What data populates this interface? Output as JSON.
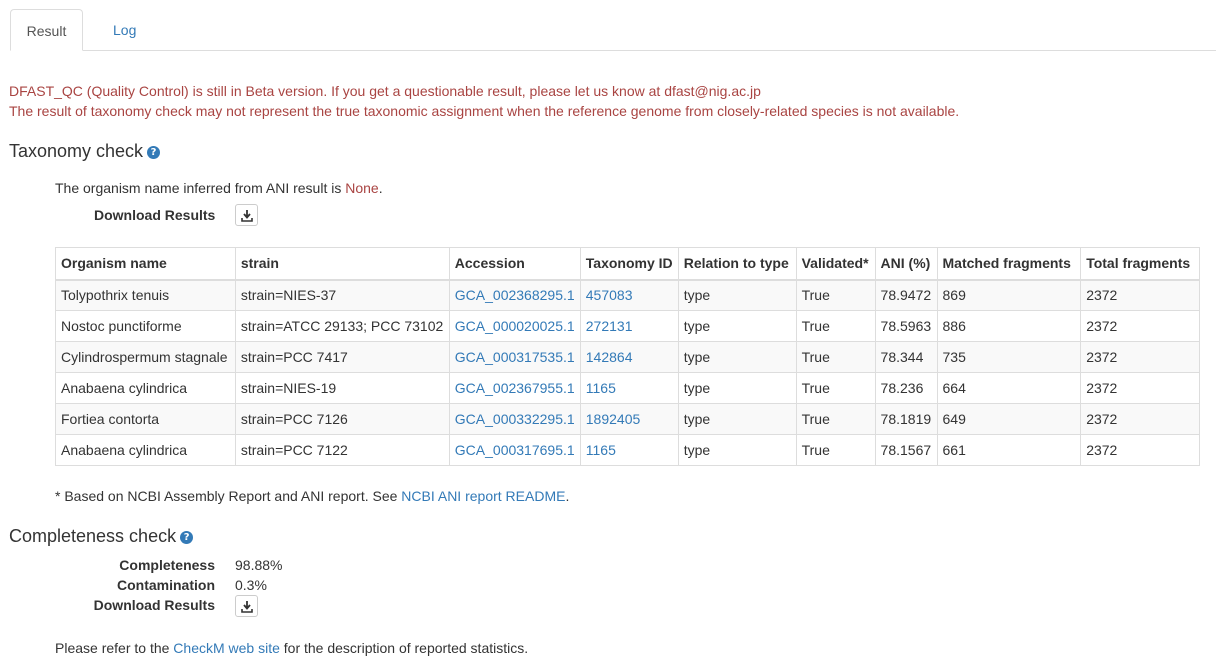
{
  "tabs": [
    {
      "label": "Result",
      "active": true
    },
    {
      "label": "Log",
      "active": false
    }
  ],
  "warnings": [
    "DFAST_QC (Quality Control) is still in Beta version. If you get a questionable result, please let us know at dfast@nig.ac.jp",
    "The result of taxonomy check may not represent the true taxonomic assignment when the reference genome from closely-related species is not available."
  ],
  "taxonomy": {
    "title": "Taxonomy check",
    "inferred_prefix": "The organism name inferred from ANI result is ",
    "inferred_value": "None",
    "inferred_suffix": ".",
    "download_label": "Download Results",
    "headers": [
      "Organism name",
      "strain",
      "Accession",
      "Taxonomy ID",
      "Relation to type",
      "Validated*",
      "ANI (%)",
      "Matched fragments",
      "Total fragments"
    ],
    "rows": [
      [
        "Tolypothrix tenuis",
        "strain=NIES-37",
        "GCA_002368295.1",
        "457083",
        "type",
        "True",
        "78.9472",
        "869",
        "2372"
      ],
      [
        "Nostoc punctiforme",
        "strain=ATCC 29133; PCC 73102",
        "GCA_000020025.1",
        "272131",
        "type",
        "True",
        "78.5963",
        "886",
        "2372"
      ],
      [
        "Cylindrospermum stagnale",
        "strain=PCC 7417",
        "GCA_000317535.1",
        "142864",
        "type",
        "True",
        "78.344",
        "735",
        "2372"
      ],
      [
        "Anabaena cylindrica",
        "strain=NIES-19",
        "GCA_002367955.1",
        "1165",
        "type",
        "True",
        "78.236",
        "664",
        "2372"
      ],
      [
        "Fortiea contorta",
        "strain=PCC 7126",
        "GCA_000332295.1",
        "1892405",
        "type",
        "True",
        "78.1819",
        "649",
        "2372"
      ],
      [
        "Anabaena cylindrica",
        "strain=PCC 7122",
        "GCA_000317695.1",
        "1165",
        "type",
        "True",
        "78.1567",
        "661",
        "2372"
      ]
    ],
    "footnote_prefix": "* Based on NCBI Assembly Report and ANI report. See ",
    "footnote_link": "NCBI ANI report README",
    "footnote_suffix": "."
  },
  "completeness": {
    "title": "Completeness check",
    "completeness_label": "Completeness",
    "completeness_value": "98.88%",
    "contamination_label": "Contamination",
    "contamination_value": "0.3%",
    "download_label": "Download Results",
    "refer_prefix": "Please refer to the ",
    "refer_link": "CheckM web site",
    "refer_suffix": " for the description of reported statistics."
  },
  "colors": {
    "link": "#337ab7",
    "warning": "#a94442",
    "border": "#dddddd",
    "stripe": "#f9f9f9"
  },
  "icons": {
    "help": "question-circle-icon",
    "download": "download-icon"
  }
}
